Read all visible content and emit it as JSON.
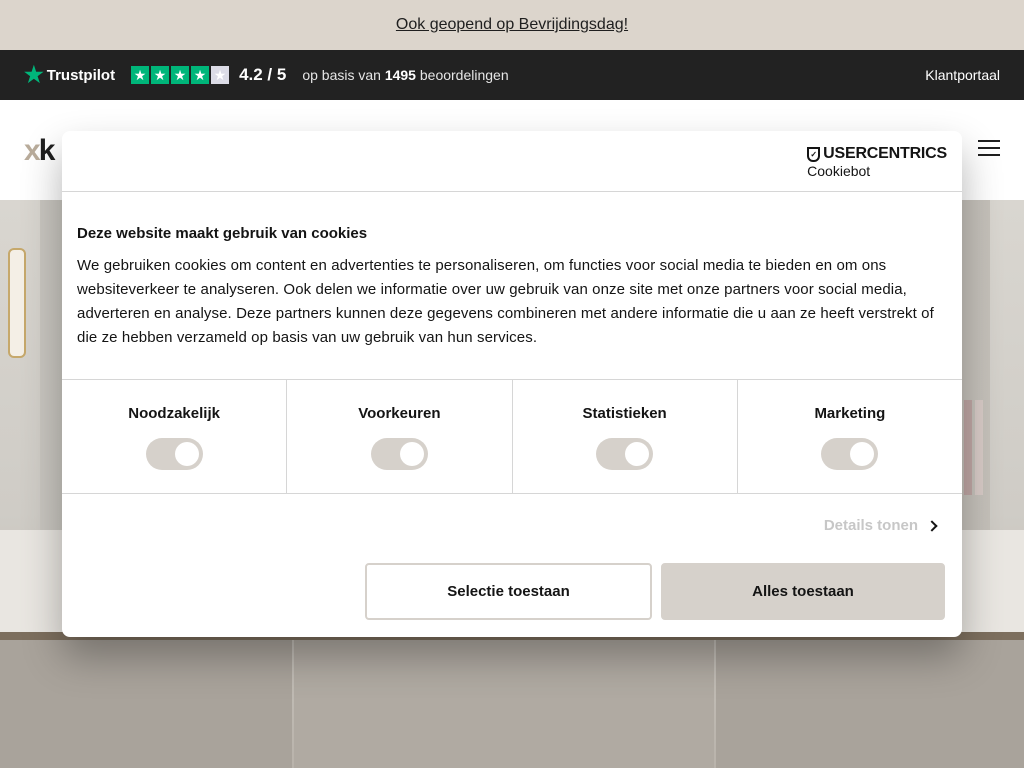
{
  "announcement": {
    "text": "Ook geopend op Bevrijdingsdag!"
  },
  "trustpilot": {
    "brand": "Trustpilot",
    "score": "4.2 / 5",
    "basis_prefix": "op basis van",
    "count": "1495",
    "basis_suffix": "beoordelingen",
    "stars_filled": 4,
    "stars_total": 5,
    "accent_color": "#00b67a"
  },
  "header": {
    "portal_link": "Klantportaal",
    "menu_icon": "hamburger-menu-icon"
  },
  "cookie_dialog": {
    "brand": {
      "name": "USERCENTRICS",
      "product": "Cookiebot"
    },
    "title": "Deze website maakt gebruik van cookies",
    "body": "We gebruiken cookies om content en advertenties te personaliseren, om functies voor social media te bieden en om ons websiteverkeer te analyseren. Ook delen we informatie over uw gebruik van onze site met onze partners voor social media, adverteren en analyse. Deze partners kunnen deze gegevens combineren met andere informatie die u aan ze heeft verstrekt of die ze hebben verzameld op basis van uw gebruik van hun services.",
    "categories": [
      {
        "label": "Noodzakelijk",
        "enabled": true
      },
      {
        "label": "Voorkeuren",
        "enabled": true
      },
      {
        "label": "Statistieken",
        "enabled": true
      },
      {
        "label": "Marketing",
        "enabled": true
      }
    ],
    "details_label": "Details tonen",
    "buttons": {
      "select": "Selectie toestaan",
      "all": "Alles toestaan"
    },
    "accent_color": "#d6d1cb"
  }
}
